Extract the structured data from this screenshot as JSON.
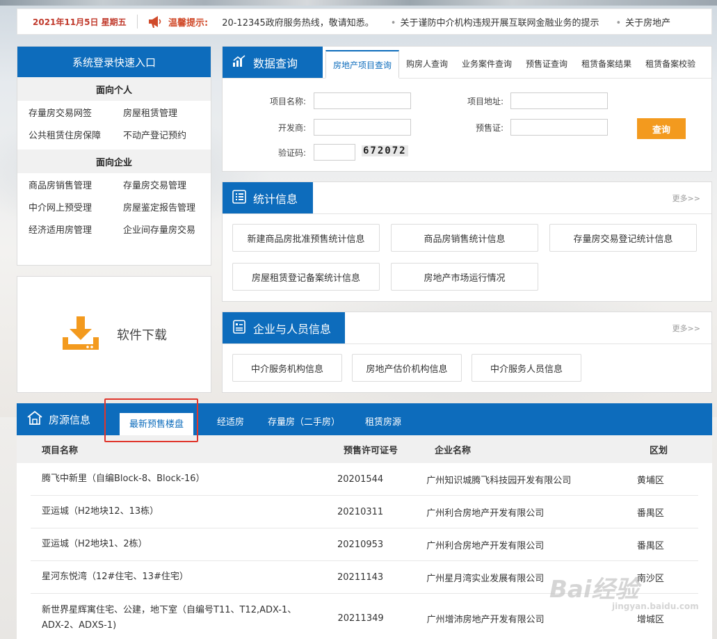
{
  "notice": {
    "date": "2021年11月5日 星期五",
    "tip_label": "温馨提示:",
    "items": [
      "20-12345政府服务热线，敬请知悉。",
      "关于谨防中介机构违规开展互联网金融业务的提示",
      "关于房地产"
    ]
  },
  "login": {
    "title": "系统登录快速入口",
    "personal_header": "面向个人",
    "personal_links": [
      "存量房交易网签",
      "房屋租赁管理",
      "公共租赁住房保障",
      "不动产登记预约"
    ],
    "enterprise_header": "面向企业",
    "enterprise_links": [
      "商品房销售管理",
      "存量房交易管理",
      "中介网上预受理",
      "房屋鉴定报告管理",
      "经济适用房管理",
      "企业间存量房交易"
    ]
  },
  "download": {
    "label": "软件下载"
  },
  "query": {
    "title": "数据查询",
    "tabs": [
      "房地产项目查询",
      "购房人查询",
      "业务案件查询",
      "预售证查询",
      "租赁备案结果",
      "租赁备案校验"
    ],
    "fields": {
      "project_name": "项目名称:",
      "project_address": "项目地址:",
      "developer": "开发商:",
      "presale_cert": "预售证:",
      "captcha": "验证码:"
    },
    "captcha_value": "672072",
    "submit": "查询"
  },
  "stats": {
    "title": "统计信息",
    "more": "更多>>",
    "buttons": [
      "新建商品房批准预售统计信息",
      "商品房销售统计信息",
      "存量房交易登记统计信息",
      "房屋租赁登记备案统计信息",
      "房地产市场运行情况"
    ]
  },
  "enterprise": {
    "title": "企业与人员信息",
    "more": "更多>>",
    "buttons": [
      "中介服务机构信息",
      "房地产估价机构信息",
      "中介服务人员信息"
    ]
  },
  "housing": {
    "title": "房源信息",
    "tabs": [
      "最新预售楼盘",
      "经适房",
      "存量房（二手房）",
      "租赁房源"
    ],
    "columns": [
      "项目名称",
      "预售许可证号",
      "企业名称",
      "区划"
    ],
    "rows": [
      [
        "腾飞中新里（自编Block-8、Block-16）",
        "20201544",
        "广州知识城腾飞科技园开发有限公司",
        "黄埔区"
      ],
      [
        "亚运城（H2地块12、13栋）",
        "20210311",
        "广州利合房地产开发有限公司",
        "番禺区"
      ],
      [
        "亚运城（H2地块1、2栋）",
        "20210953",
        "广州利合房地产开发有限公司",
        "番禺区"
      ],
      [
        "星河东悦湾（12#住宅、13#住宅）",
        "20211143",
        "广州星月湾实业发展有限公司",
        "南沙区"
      ],
      [
        "新世界星辉寓住宅、公建，地下室（自编号T11、T12,ADX-1、ADX-2、ADXS-1)",
        "20211349",
        "广州增沛房地产开发有限公司",
        "增城区"
      ]
    ]
  },
  "watermark": {
    "main": "Bai经验",
    "sub": "jingyan.baidu.com"
  },
  "colors": {
    "primary": "#0d6cbc",
    "accent": "#f39a1e",
    "highlight": "#e0352b"
  }
}
